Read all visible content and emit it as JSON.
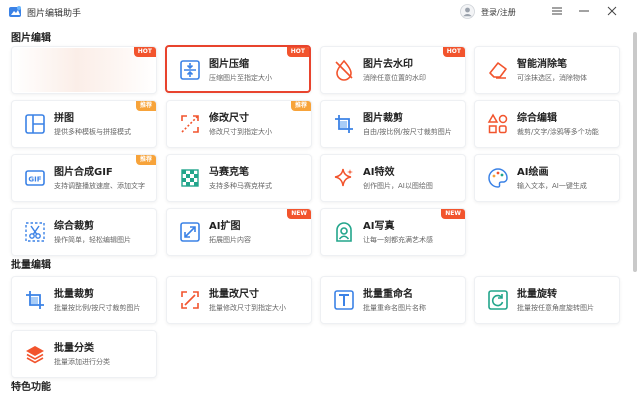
{
  "app": {
    "title": "图片编辑助手",
    "login": "登录/注册"
  },
  "sections": {
    "image_edit": "图片编辑",
    "batch_edit": "批量编辑",
    "special": "特色功能"
  },
  "colors": {
    "accent": "#3b82e6",
    "hot": "#f2542d",
    "recommend": "#f7a33a",
    "selected_border": "#e8432d"
  },
  "cards": [
    {
      "title": "",
      "desc": "",
      "badge": "HOT",
      "icon": "blurred-icon"
    },
    {
      "title": "图片压缩",
      "desc": "压缩图片至指定大小",
      "badge": "HOT",
      "icon": "compress-icon"
    },
    {
      "title": "图片去水印",
      "desc": "消除任意位置的水印",
      "badge": "HOT",
      "icon": "watermark-remove-icon"
    },
    {
      "title": "智能消除笔",
      "desc": "可涂抹选区，消除物体",
      "badge": "",
      "icon": "eraser-icon"
    },
    {
      "title": "拼图",
      "desc": "提供多种模板与拼接模式",
      "badge": "推荐",
      "icon": "collage-icon"
    },
    {
      "title": "修改尺寸",
      "desc": "修改尺寸到指定大小",
      "badge": "推荐",
      "icon": "resize-icon"
    },
    {
      "title": "图片裁剪",
      "desc": "自由/按比例/按尺寸裁剪图片",
      "badge": "",
      "icon": "crop-icon"
    },
    {
      "title": "综合编辑",
      "desc": "裁剪/文字/涂鸦等多个功能",
      "badge": "",
      "icon": "shapes-icon"
    },
    {
      "title": "图片合成GIF",
      "desc": "支持调整播放速度、添加文字",
      "badge": "推荐",
      "icon": "gif-icon"
    },
    {
      "title": "马赛克笔",
      "desc": "支持多种马赛克样式",
      "badge": "",
      "icon": "mosaic-icon"
    },
    {
      "title": "AI特效",
      "desc": "创作图片，AI以图绘图",
      "badge": "",
      "icon": "sparkle-icon"
    },
    {
      "title": "AI绘画",
      "desc": "输入文本，AI一键生成",
      "badge": "",
      "icon": "palette-icon"
    },
    {
      "title": "综合裁剪",
      "desc": "操作简单，轻松编辑图片",
      "badge": "",
      "icon": "scissors-icon"
    },
    {
      "title": "AI扩图",
      "desc": "拓展图片内容",
      "badge": "NEW",
      "icon": "expand-icon"
    },
    {
      "title": "AI写真",
      "desc": "让每一刻都充满艺术感",
      "badge": "NEW",
      "icon": "portrait-icon"
    }
  ],
  "batch_cards": [
    {
      "title": "批量裁剪",
      "desc": "批量按比例/按尺寸裁剪图片",
      "icon": "crop-icon"
    },
    {
      "title": "批量改尺寸",
      "desc": "批量修改尺寸到指定大小",
      "icon": "resize-icon"
    },
    {
      "title": "批量重命名",
      "desc": "批量重命名图片名称",
      "icon": "text-icon"
    },
    {
      "title": "批量旋转",
      "desc": "批量按任意角度旋转图片",
      "icon": "rotate-icon"
    },
    {
      "title": "批量分类",
      "desc": "批量添加进行分类",
      "icon": "layers-icon"
    }
  ]
}
